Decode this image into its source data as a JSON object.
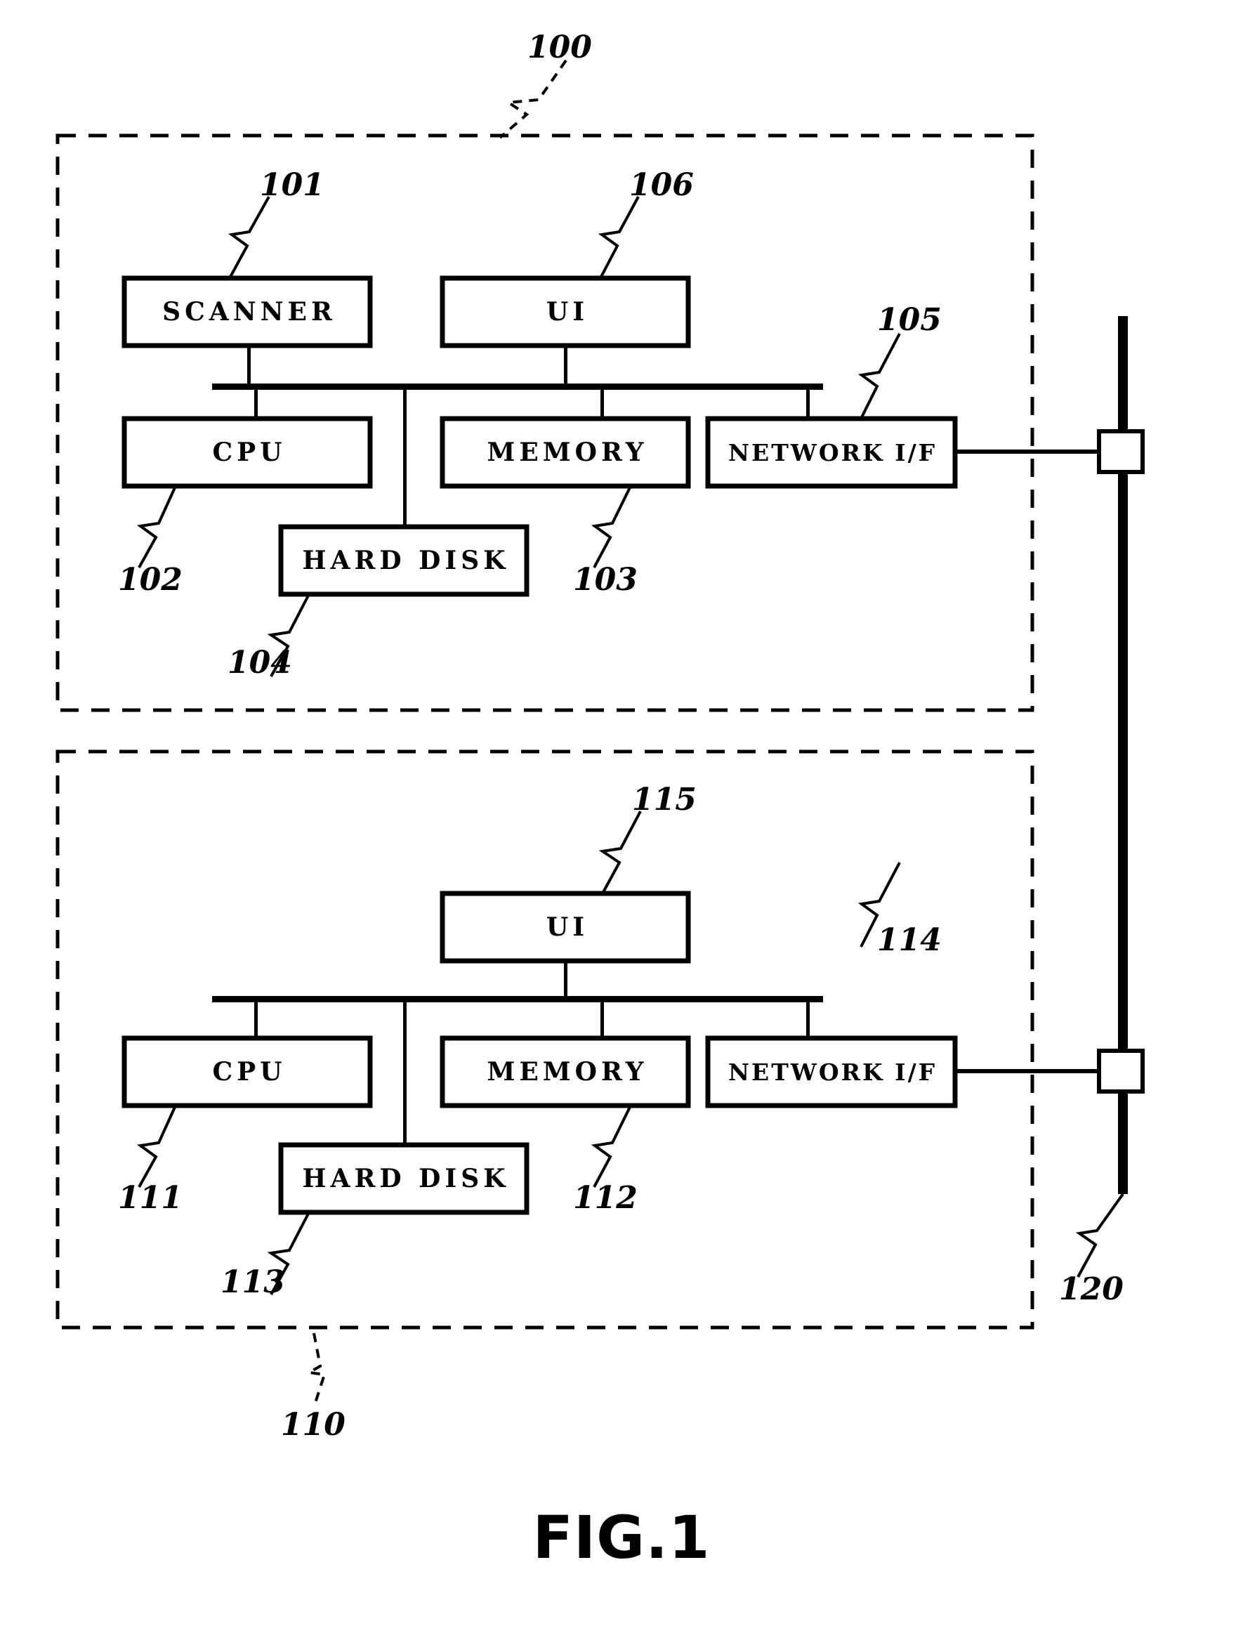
{
  "figure": {
    "caption": "FIG.1",
    "title": "System block diagram"
  },
  "devices": [
    {
      "id": "device-100",
      "ref": "100",
      "blocks": [
        {
          "key": "scanner",
          "label": "SCANNER",
          "ref": "101"
        },
        {
          "key": "ui",
          "label": "UI",
          "ref": "106"
        },
        {
          "key": "cpu",
          "label": "CPU",
          "ref": "102"
        },
        {
          "key": "memory",
          "label": "MEMORY",
          "ref": "103"
        },
        {
          "key": "hdd",
          "label": "HARD DISK",
          "ref": "104"
        },
        {
          "key": "netif",
          "label": "NETWORK I/F",
          "ref": "105"
        }
      ]
    },
    {
      "id": "device-110",
      "ref": "110",
      "blocks": [
        {
          "key": "ui",
          "label": "UI",
          "ref": "115"
        },
        {
          "key": "cpu",
          "label": "CPU",
          "ref": "111"
        },
        {
          "key": "memory",
          "label": "MEMORY",
          "ref": "112"
        },
        {
          "key": "hdd",
          "label": "HARD DISK",
          "ref": "113"
        },
        {
          "key": "netif",
          "label": "NETWORK I/F",
          "ref": "114"
        }
      ]
    }
  ],
  "network": {
    "ref": "120"
  },
  "colors": {
    "ink": "#000000",
    "paper": "#ffffff"
  }
}
